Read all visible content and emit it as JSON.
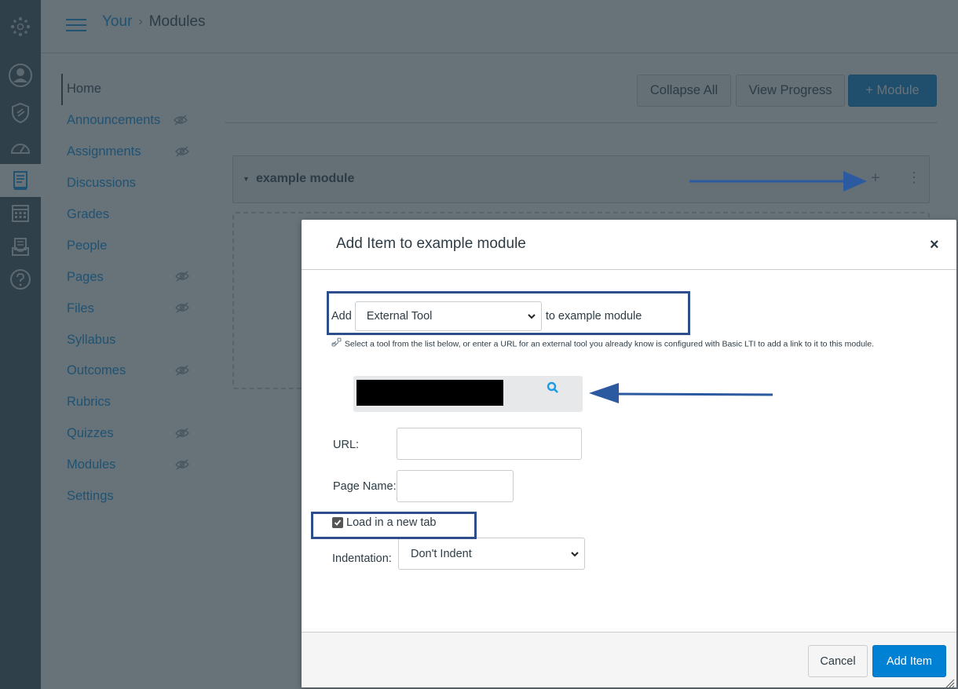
{
  "breadcrumb": {
    "course": "Your",
    "separator": "›",
    "current": "Modules"
  },
  "global_nav": {
    "items": [
      {
        "icon": "canvas-logo-icon"
      },
      {
        "icon": "account-icon"
      },
      {
        "icon": "admin-shield-icon"
      },
      {
        "icon": "dashboard-icon"
      },
      {
        "icon": "courses-icon",
        "active": true
      },
      {
        "icon": "calendar-icon"
      },
      {
        "icon": "inbox-icon"
      },
      {
        "icon": "help-icon"
      }
    ]
  },
  "course_nav": {
    "items": [
      {
        "label": "Home",
        "active": true,
        "hidden_from_students": false
      },
      {
        "label": "Announcements",
        "hidden_from_students": true
      },
      {
        "label": "Assignments",
        "hidden_from_students": true
      },
      {
        "label": "Discussions",
        "hidden_from_students": false
      },
      {
        "label": "Grades",
        "hidden_from_students": false
      },
      {
        "label": "People",
        "hidden_from_students": false
      },
      {
        "label": "Pages",
        "hidden_from_students": true
      },
      {
        "label": "Files",
        "hidden_from_students": true
      },
      {
        "label": "Syllabus",
        "hidden_from_students": false
      },
      {
        "label": "Outcomes",
        "hidden_from_students": true
      },
      {
        "label": "Rubrics",
        "hidden_from_students": false
      },
      {
        "label": "Quizzes",
        "hidden_from_students": true
      },
      {
        "label": "Modules",
        "hidden_from_students": true
      },
      {
        "label": "Settings",
        "hidden_from_students": false
      }
    ]
  },
  "toolbar": {
    "collapse_all": "Collapse All",
    "view_progress": "View Progress",
    "add_module": "+ Module"
  },
  "module": {
    "title": "example module",
    "toggle": "▼",
    "add": "+",
    "kebab": "⋮"
  },
  "dialog": {
    "title": "Add Item to example module",
    "close": "×",
    "add_label": "Add",
    "item_type": "External Tool",
    "to_module": "to example module",
    "hint": "Select a tool from the list below, or enter a URL for an external tool you already know is configured with Basic LTI to add a link to it to this module.",
    "url_label": "URL:",
    "url_value": "",
    "page_name_label": "Page Name:",
    "page_name_value": "",
    "new_tab_label": "Load in a new tab",
    "new_tab_checked": true,
    "indentation_label": "Indentation:",
    "indentation_value": "Don't Indent",
    "cancel": "Cancel",
    "add_item": "Add Item"
  },
  "colors": {
    "brand_blue": "#0081d4",
    "link_blue": "#008ee2",
    "nav_dark": "#394b58",
    "annotation_blue": "#2c4f8c"
  }
}
